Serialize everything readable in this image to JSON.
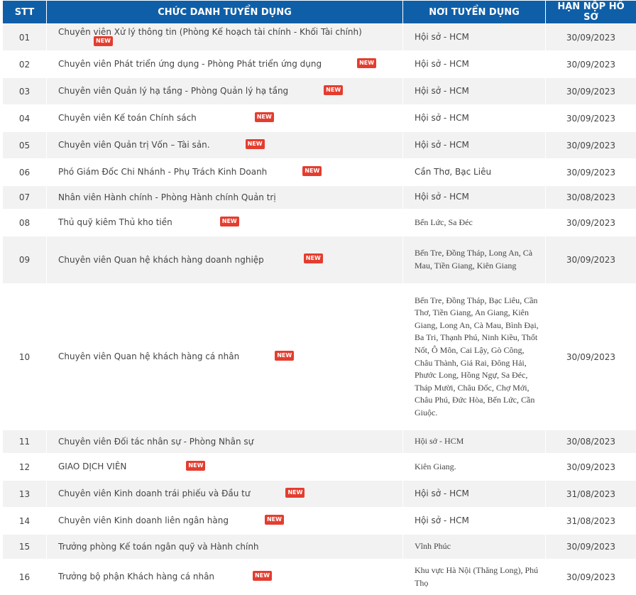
{
  "table": {
    "headers": {
      "stt": "STT",
      "title": "CHỨC DANH TUYỂN DỤNG",
      "place": "NƠI TUYỂN DỤNG",
      "deadline": "HẠN NỘP HỒ SƠ"
    },
    "badge_label": "NEW",
    "rows": [
      {
        "stt": "01",
        "title": "Chuyên viên Xử lý thông tin (Phòng Kế hoạch tài chính - Khối Tài chính)",
        "place": "Hội sở - HCM",
        "deadline": "30/09/2023",
        "is_new": true
      },
      {
        "stt": "02",
        "title": "Chuyên viên Phát triển ứng dụng - Phòng Phát triển ứng dụng",
        "place": "Hội sở - HCM",
        "deadline": "30/09/2023",
        "is_new": true
      },
      {
        "stt": "03",
        "title": "Chuyên viên Quản lý hạ tầng - Phòng Quản lý hạ tầng",
        "place": "Hội sở - HCM",
        "deadline": "30/09/2023",
        "is_new": true
      },
      {
        "stt": "04",
        "title": "Chuyên viên Kế toán Chính sách",
        "place": "Hội sở - HCM",
        "deadline": "30/09/2023",
        "is_new": true
      },
      {
        "stt": "05",
        "title": "Chuyên viên Quản trị Vốn – Tài sản.",
        "place": "Hội sở - HCM",
        "deadline": "30/09/2023",
        "is_new": true
      },
      {
        "stt": "06",
        "title": "Phó Giám Đốc Chi Nhánh - Phụ Trách Kinh Doanh",
        "place": "Cần Thơ, Bạc Liêu",
        "deadline": "30/09/2023",
        "is_new": true
      },
      {
        "stt": "07",
        "title": "Nhân viên Hành chính - Phòng Hành chính Quản trị",
        "place": "Hội sở - HCM",
        "deadline": "30/08/2023",
        "is_new": false
      },
      {
        "stt": "08",
        "title": "Thủ quỹ kiêm Thủ kho tiền",
        "place": "Bến Lức, Sa Đéc",
        "deadline": "30/09/2023",
        "is_new": true,
        "serif": true
      },
      {
        "stt": "09",
        "title": "Chuyên viên Quan hệ khách hàng doanh nghiệp",
        "place": "Bến Tre, Đồng Tháp, Long An, Cà Mau, Tiền Giang, Kiên Giang",
        "deadline": "30/09/2023",
        "is_new": true,
        "serif": true
      },
      {
        "stt": "10",
        "title": "Chuyên viên Quan hệ khách hàng cá nhân",
        "place": "Bến Tre, Đồng Tháp, Bạc Liêu, Cần Thơ, Tiền Giang, An Giang, Kiên Giang, Long An, Cà Mau, Bình Đại,  Ba Tri, Thạnh Phú, Ninh Kiều,  Thốt Nốt,  Ô Môn, Cai Lậy, Gò Công, Châu Thành, Giá Rai,  Đông Hải,  Phước Long, Hồng Ngự, Sa Đéc, Tháp Mười, Châu Đốc,  Chợ Mới, Châu Phú,  Đức Hòa,  Bến Lức, Cần Giuộc.",
        "deadline": "30/09/2023",
        "is_new": true,
        "serif": true
      },
      {
        "stt": "11",
        "title": "Chuyên viên Đối tác nhân sự - Phòng Nhân sự",
        "place": "Hội sở - HCM",
        "deadline": "30/08/2023",
        "is_new": false,
        "serif": true
      },
      {
        "stt": "12",
        "title": "GIAO DỊCH VIÊN",
        "place": "Kiên Giang.",
        "deadline": "30/09/2023",
        "is_new": true,
        "serif": true
      },
      {
        "stt": "13",
        "title": "Chuyên viên Kinh doanh trái phiếu và Đầu tư",
        "place": "Hội sở - HCM",
        "deadline": "31/08/2023",
        "is_new": true
      },
      {
        "stt": "14",
        "title": "Chuyên viên Kinh doanh liên ngân hàng",
        "place": "Hội sở - HCM",
        "deadline": "31/08/2023",
        "is_new": true
      },
      {
        "stt": "15",
        "title": "Trưởng phòng Kế toán ngân quỹ và Hành chính",
        "place": "Vĩnh Phúc",
        "deadline": "30/09/2023",
        "is_new": false,
        "serif": true
      },
      {
        "stt": "16",
        "title": "Trưởng bộ phận Khách hàng cá nhân",
        "place": "Khu vực Hà Nội (Thăng Long), Phú Thọ",
        "deadline": "30/09/2023",
        "is_new": true,
        "serif": true
      }
    ]
  },
  "colors": {
    "header_bg": "#0f5fa8",
    "row_alt_bg": "#f2f2f2",
    "badge_bg": "#e43d2f"
  }
}
